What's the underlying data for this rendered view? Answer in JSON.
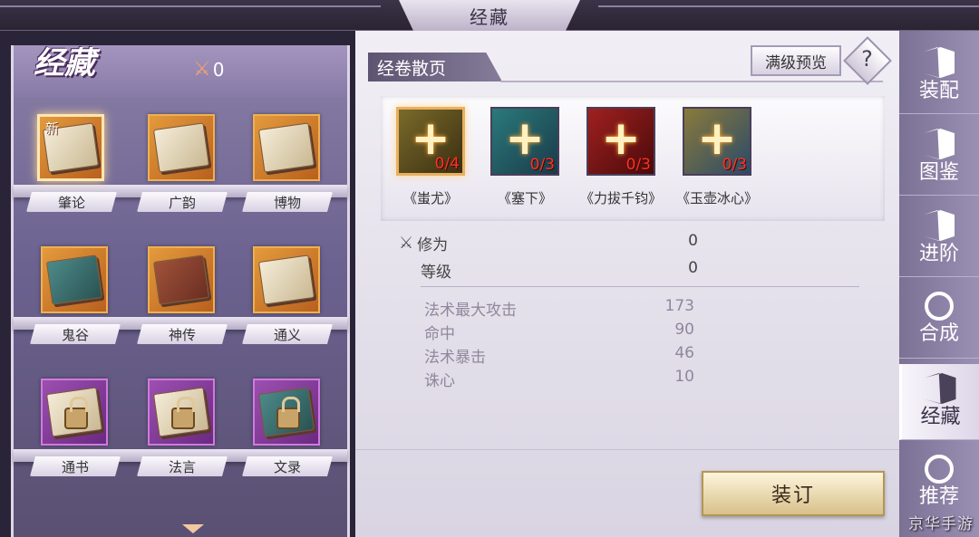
{
  "header": {
    "title": "经藏"
  },
  "left": {
    "title": "经藏",
    "currency": {
      "icon": "crossed-swords-icon",
      "value": "0"
    },
    "books": [
      {
        "label": "肇论",
        "new_tag": "新",
        "locked": false,
        "selected": true
      },
      {
        "label": "广韵",
        "locked": false
      },
      {
        "label": "博物",
        "locked": false
      },
      {
        "label": "鬼谷",
        "locked": false
      },
      {
        "label": "神传",
        "locked": false
      },
      {
        "label": "通义",
        "locked": false
      },
      {
        "label": "通书",
        "locked": true
      },
      {
        "label": "法言",
        "locked": true
      },
      {
        "label": "文录",
        "locked": true
      }
    ]
  },
  "content": {
    "section_title": "经卷散页",
    "preview_button": "满级预览",
    "help_button": "?",
    "pages": [
      {
        "name": "《蚩尤》",
        "count": "0/4",
        "color": "#6b5a2a"
      },
      {
        "name": "《塞下》",
        "count": "0/3",
        "color": "#2a6a6a"
      },
      {
        "name": "《力拔千钧》",
        "count": "0/3",
        "color": "#8a1a1a"
      },
      {
        "name": "《玉壶冰心》",
        "count": "0/3",
        "color": "#4a6a8a"
      }
    ],
    "stats": {
      "cultivation": {
        "label": "修为",
        "value": "0"
      },
      "level": {
        "label": "等级",
        "value": "0"
      }
    },
    "attributes": [
      {
        "label": "法术最大攻击",
        "value": "173"
      },
      {
        "label": "命中",
        "value": "90"
      },
      {
        "label": "法术暴击",
        "value": "46"
      },
      {
        "label": "诛心",
        "value": "10"
      }
    ],
    "bind_button": "装订"
  },
  "sidebar": {
    "tabs": [
      {
        "label": "装配",
        "icon": "book-icon",
        "active": false
      },
      {
        "label": "图鉴",
        "icon": "book-icon",
        "active": false
      },
      {
        "label": "进阶",
        "icon": "book-icon",
        "active": false
      },
      {
        "label": "合成",
        "icon": "cycle-icon",
        "active": false
      },
      {
        "label": "经藏",
        "icon": "book-icon",
        "active": true
      },
      {
        "label": "推荐",
        "icon": "thumbs-up-icon",
        "active": false
      }
    ]
  },
  "watermark": "京华手游",
  "colors": {
    "accent": "#e8b060",
    "panel": "#f1eff5",
    "sidebar": "#8a80a4"
  }
}
